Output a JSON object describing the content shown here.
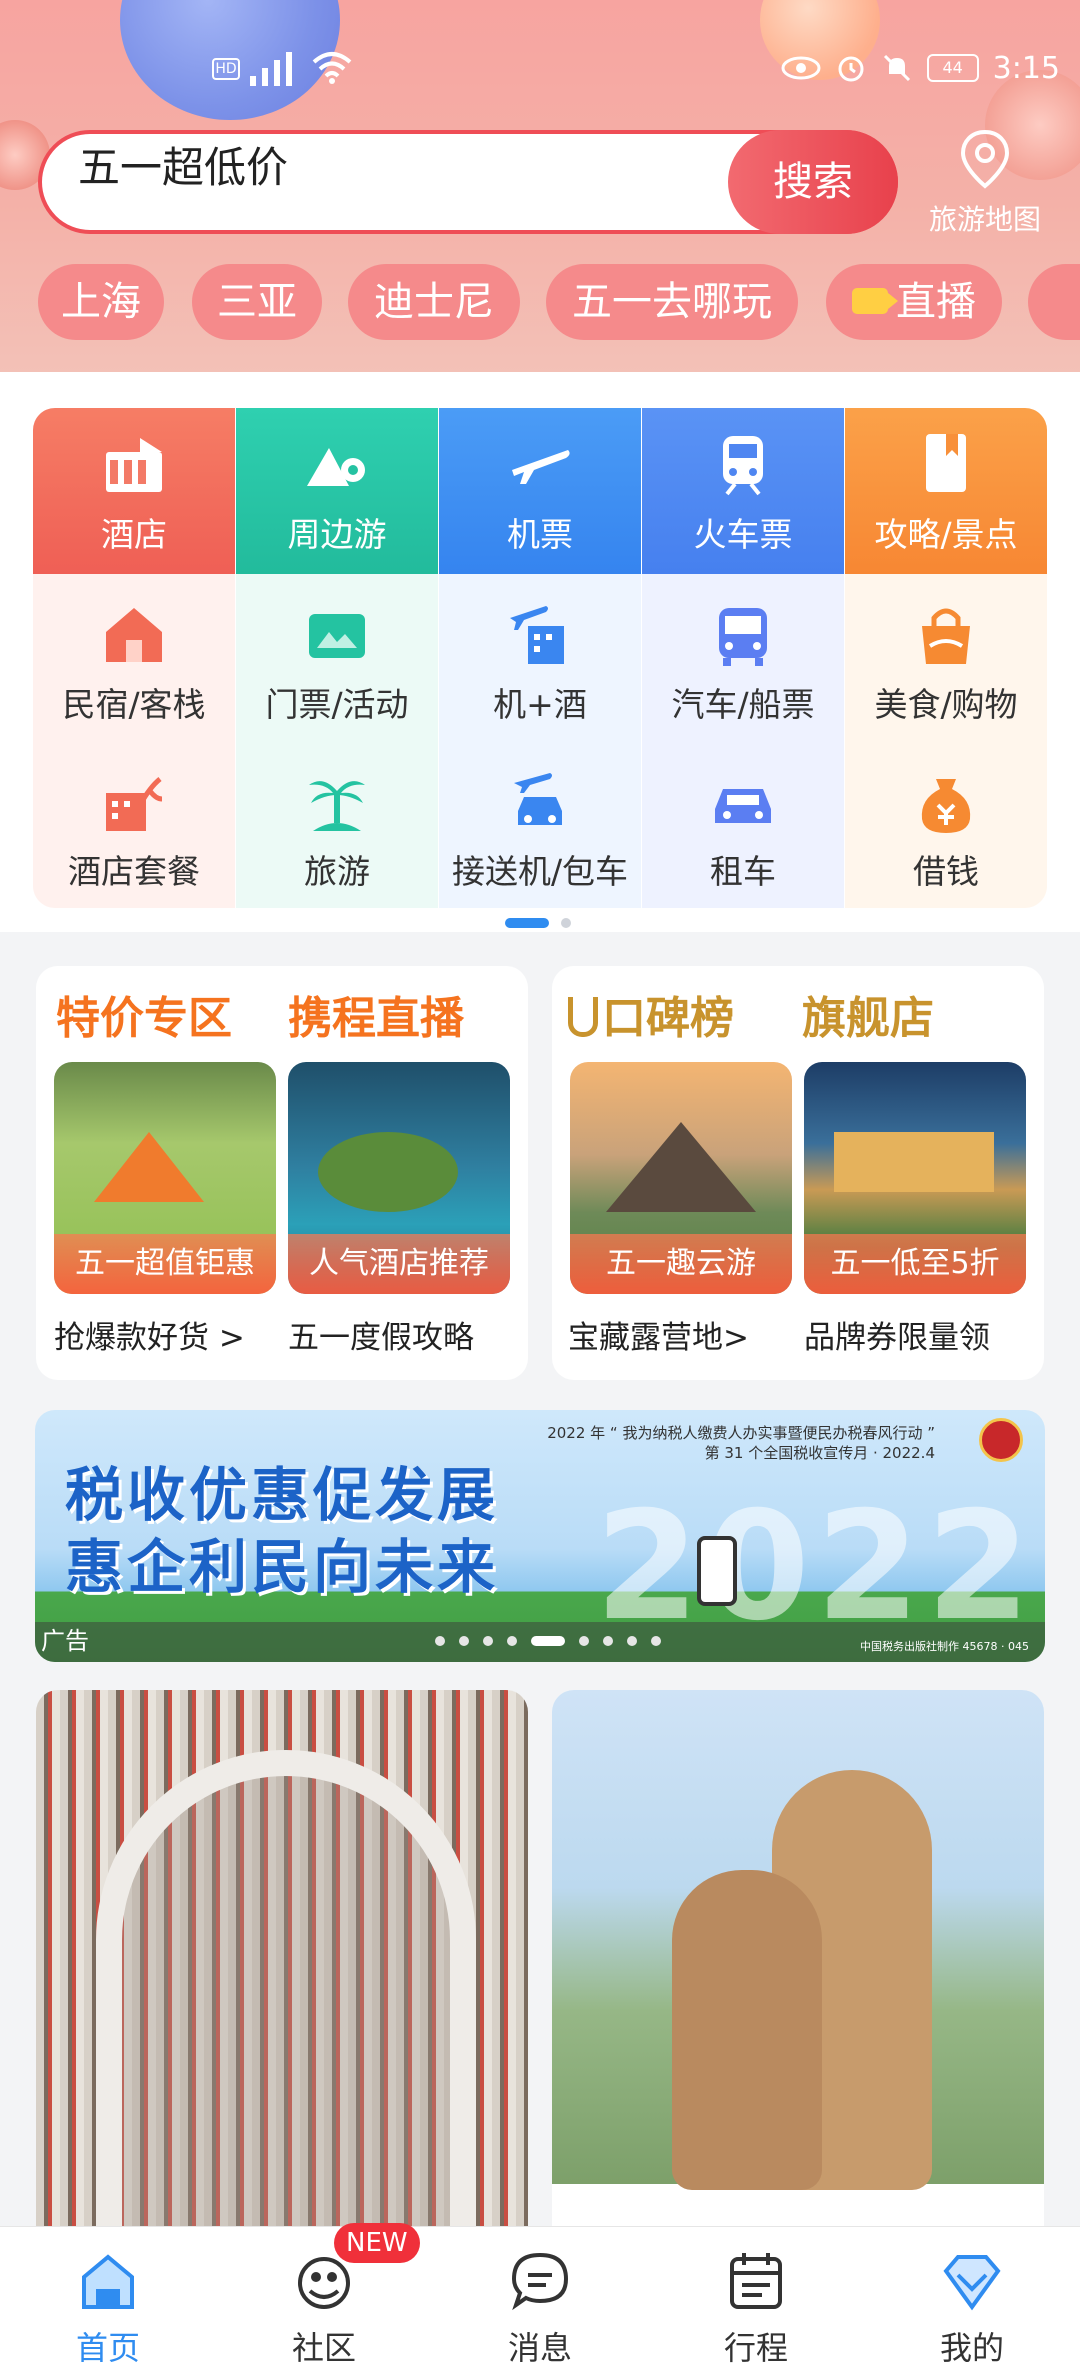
{
  "status_bar": {
    "network": "HD",
    "battery": "44",
    "time": "3:15"
  },
  "search": {
    "query": "五一超低价",
    "button": "搜索",
    "map_label": "旅游地图"
  },
  "chips": [
    "上海",
    "三亚",
    "迪士尼",
    "五一去哪玩",
    "直播"
  ],
  "grid": {
    "row1": [
      {
        "label": "酒店",
        "icon": "hotel-icon",
        "color": "#f2635d"
      },
      {
        "label": "周边游",
        "icon": "mountain-pin-icon",
        "color": "#25c2a2"
      },
      {
        "label": "机票",
        "icon": "plane-icon",
        "color": "#3e8cf3"
      },
      {
        "label": "火车票",
        "icon": "train-icon",
        "color": "#4f86f1"
      },
      {
        "label": "攻略/景点",
        "icon": "guidebook-icon",
        "color": "#f8903a"
      }
    ],
    "row2": [
      {
        "label": "民宿/客栈",
        "icon": "house-icon"
      },
      {
        "label": "门票/活动",
        "icon": "ticket-icon"
      },
      {
        "label": "机+酒",
        "icon": "plane-hotel-icon"
      },
      {
        "label": "汽车/船票",
        "icon": "bus-icon"
      },
      {
        "label": "美食/购物",
        "icon": "shopping-bag-icon"
      }
    ],
    "row3": [
      {
        "label": "酒店套餐",
        "icon": "hotel-package-icon"
      },
      {
        "label": "旅游",
        "icon": "palm-tree-icon"
      },
      {
        "label": "接送机/包车",
        "icon": "airport-car-icon"
      },
      {
        "label": "租车",
        "icon": "car-icon"
      },
      {
        "label": "借钱",
        "icon": "money-bag-icon"
      }
    ]
  },
  "promo_left": {
    "titles": [
      "特价专区",
      "携程直播"
    ],
    "tags": [
      "五一超值钜惠",
      "人气酒店推荐"
    ],
    "subs": [
      "抢爆款好货 >",
      "五一度假攻略"
    ]
  },
  "promo_right": {
    "titles": [
      "口碑榜",
      "旗舰店"
    ],
    "tags": [
      "五一趣云游",
      "五一低至5折"
    ],
    "subs": [
      "宝藏露营地>",
      "品牌券限量领"
    ]
  },
  "ad": {
    "line1": "税收优惠促发展",
    "line2": "惠企利民向未来",
    "top_text": "2022 年 “ 我为纳税人缴费人办实事暨便民办税春风行动 ”",
    "top_text2": "第 31 个全国税收宣传月 · 2022.4",
    "year": "2022",
    "label": "广告",
    "credit": "中国税务出版社制作 45678 · 045"
  },
  "nav": [
    {
      "label": "首页",
      "icon": "home-icon",
      "active": true
    },
    {
      "label": "社区",
      "icon": "community-icon",
      "badge": "NEW"
    },
    {
      "label": "消息",
      "icon": "message-icon"
    },
    {
      "label": "行程",
      "icon": "itinerary-icon"
    },
    {
      "label": "我的",
      "icon": "profile-diamond-icon"
    }
  ],
  "colors": {
    "accent": "#2f8cf0",
    "search_red": "#e8414c",
    "promo_orange": "#f5731f",
    "promo_gold": "#c8932d"
  }
}
